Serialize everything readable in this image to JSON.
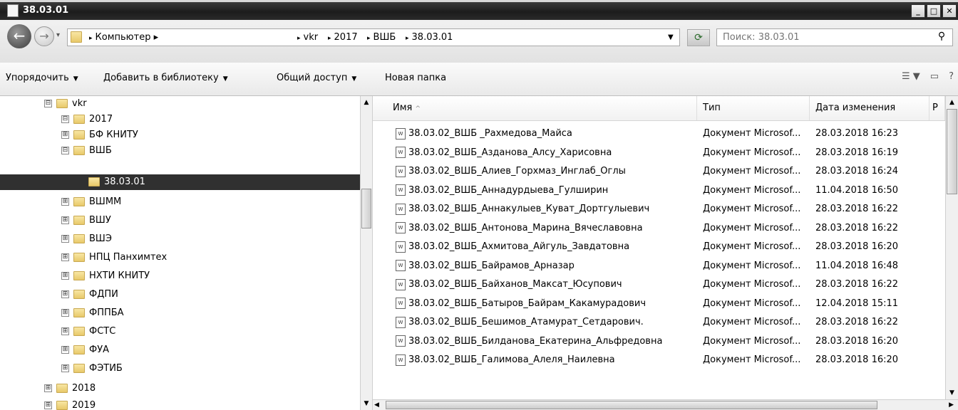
{
  "window": {
    "title": "38.03.01"
  },
  "address": {
    "crumbs": [
      "Компьютер",
      "vkr",
      "2017",
      "ВШБ",
      "38.03.01"
    ]
  },
  "search": {
    "placeholder": "Поиск: 38.03.01"
  },
  "toolbar": {
    "organize": "Упорядочить",
    "add_library": "Добавить в библиотеку",
    "share": "Общий доступ",
    "new_folder": "Новая папка"
  },
  "tree": [
    {
      "label": "vkr",
      "expander": "⊟"
    },
    {
      "label": "2017",
      "expander": "⊟"
    },
    {
      "label": "БФ КНИТУ",
      "expander": "⊞"
    },
    {
      "label": "ВШБ",
      "expander": "⊟"
    },
    {
      "label": "38.03.01",
      "expander": ""
    },
    {
      "label": "ВШММ",
      "expander": "⊞"
    },
    {
      "label": "ВШУ",
      "expander": "⊞"
    },
    {
      "label": "ВШЭ",
      "expander": "⊞"
    },
    {
      "label": "НПЦ Панхимтех",
      "expander": "⊞"
    },
    {
      "label": "НХТИ КНИТУ",
      "expander": "⊞"
    },
    {
      "label": "ФДПИ",
      "expander": "⊞"
    },
    {
      "label": "ФППБА",
      "expander": "⊞"
    },
    {
      "label": "ФСТС",
      "expander": "⊞"
    },
    {
      "label": "ФУА",
      "expander": "⊞"
    },
    {
      "label": "ФЭТИБ",
      "expander": "⊞"
    },
    {
      "label": "2018",
      "expander": "⊞"
    },
    {
      "label": "2019",
      "expander": "⊞"
    }
  ],
  "columns": {
    "name": "Имя",
    "type": "Тип",
    "date": "Дата изменения",
    "size": "Р"
  },
  "files": [
    {
      "name": "38.03.02_ВШБ _Рахмедова_Майса",
      "type": "Документ Microsof...",
      "date": "28.03.2018 16:23"
    },
    {
      "name": "38.03.02_ВШБ_Азданова_Алсу_Харисовна",
      "type": "Документ Microsof...",
      "date": "28.03.2018 16:19"
    },
    {
      "name": "38.03.02_ВШБ_Алиев_Горхмаз_Инглаб_Оглы",
      "type": "Документ Microsof...",
      "date": "28.03.2018 16:24"
    },
    {
      "name": "38.03.02_ВШБ_Аннадурдыева_Гулширин",
      "type": "Документ Microsof...",
      "date": "11.04.2018 16:50"
    },
    {
      "name": "38.03.02_ВШБ_Аннакулыев_Куват_Дортгулыевич",
      "type": "Документ Microsof...",
      "date": "28.03.2018 16:22"
    },
    {
      "name": "38.03.02_ВШБ_Антонова_Марина_Вячеславовна",
      "type": "Документ Microsof...",
      "date": "28.03.2018 16:22"
    },
    {
      "name": "38.03.02_ВШБ_Ахмитова_Айгуль_Завдатовна",
      "type": "Документ Microsof...",
      "date": "28.03.2018 16:20"
    },
    {
      "name": "38.03.02_ВШБ_Байрамов_Арназар",
      "type": "Документ Microsof...",
      "date": "11.04.2018 16:48"
    },
    {
      "name": "38.03.02_ВШБ_Байханов_Максат_Юсупович",
      "type": "Документ Microsof...",
      "date": "28.03.2018 16:22"
    },
    {
      "name": "38.03.02_ВШБ_Батыров_Байрам_Какамурадович",
      "type": "Документ Microsof...",
      "date": "12.04.2018 15:11"
    },
    {
      "name": "38.03.02_ВШБ_Бешимов_Атамурат_Сетдарович.",
      "type": "Документ Microsof...",
      "date": "28.03.2018 16:22"
    },
    {
      "name": "38.03.02_ВШБ_Билданова_Екатерина_Альфредовна",
      "type": "Документ Microsof...",
      "date": "28.03.2018 16:20"
    },
    {
      "name": "38.03.02_ВШБ_Галимова_Алеля_Наилевна",
      "type": "Документ Microsof...",
      "date": "28.03.2018 16:20"
    }
  ]
}
